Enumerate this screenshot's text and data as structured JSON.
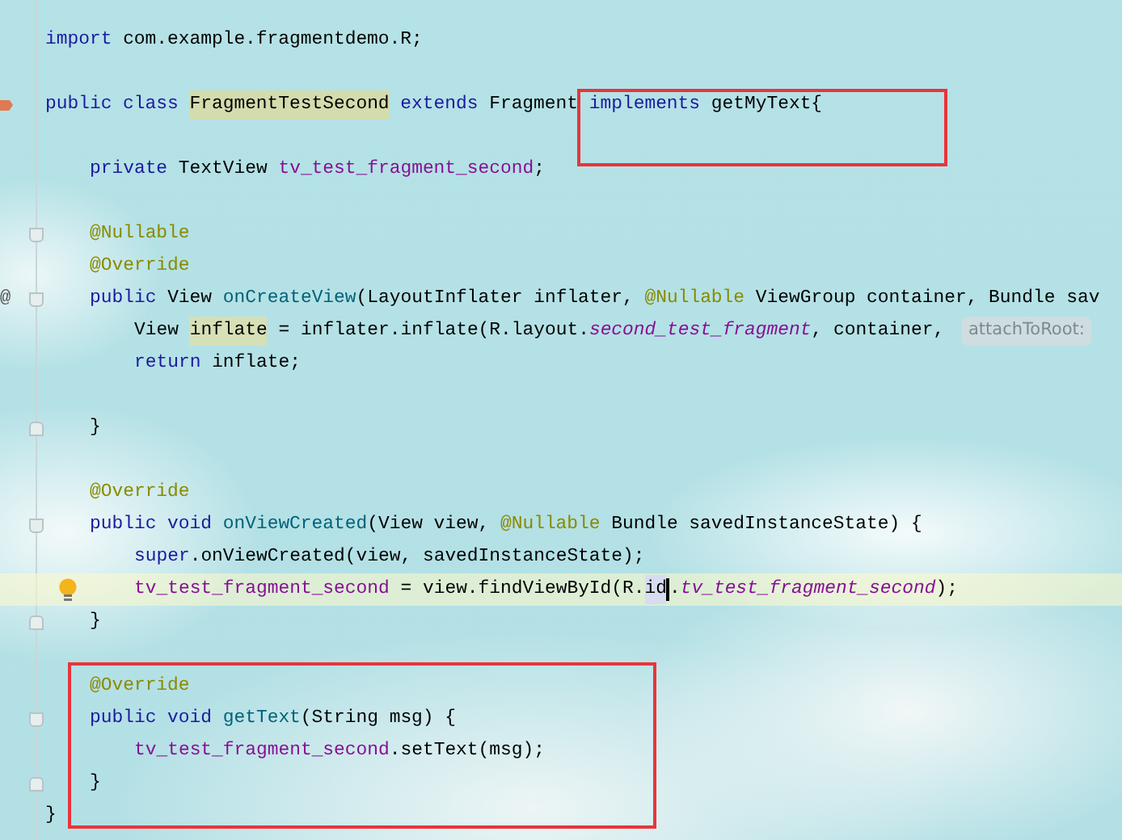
{
  "lines": [
    {
      "kind": "code",
      "tokens": [
        {
          "text": "import",
          "kind": "keyword"
        },
        {
          "text": " com.example.fragmentdemo.R;",
          "kind": "plain"
        }
      ]
    },
    {
      "kind": "blank"
    },
    {
      "kind": "code",
      "implemented_marker": true,
      "tokens": [
        {
          "text": "public class ",
          "kind": "keyword"
        },
        {
          "text": "FragmentTestSecond",
          "kind": "class-highlight"
        },
        {
          "text": " extends ",
          "kind": "keyword"
        },
        {
          "text": "Fragment ",
          "kind": "plain"
        },
        {
          "text": "implements",
          "kind": "keyword"
        },
        {
          "text": " getMyText{",
          "kind": "plain"
        }
      ],
      "children": [
        {
          "kind": "blank"
        },
        {
          "kind": "code",
          "tokens": [
            {
              "text": "private",
              "kind": "keyword"
            },
            {
              "text": " TextView ",
              "kind": "plain"
            },
            {
              "text": "tv_test_fragment_second",
              "kind": "field"
            },
            {
              "text": ";",
              "kind": "plain"
            }
          ]
        },
        {
          "kind": "blank"
        },
        {
          "kind": "code",
          "fold_start": true,
          "tokens": [
            {
              "text": "@Nullable",
              "kind": "annotation"
            }
          ]
        },
        {
          "kind": "code",
          "tokens": [
            {
              "text": "@Override",
              "kind": "annotation"
            }
          ]
        },
        {
          "kind": "code",
          "fold_start": true,
          "gutter_text": "@",
          "tokens": [
            {
              "text": "public",
              "kind": "keyword"
            },
            {
              "text": " View ",
              "kind": "plain"
            },
            {
              "text": "onCreateView",
              "kind": "method"
            },
            {
              "text": "(LayoutInflater inflater, ",
              "kind": "plain"
            },
            {
              "text": "@Nullable",
              "kind": "annotation"
            },
            {
              "text": " ViewGroup container, Bundle sav",
              "kind": "plain"
            }
          ],
          "children": [
            {
              "kind": "code",
              "tokens": [
                {
                  "text": "View ",
                  "kind": "plain"
                },
                {
                  "text": "inflate",
                  "kind": "variable-highlight"
                },
                {
                  "text": " = inflater.inflate(R.layout.",
                  "kind": "plain"
                },
                {
                  "text": "second_test_fragment",
                  "kind": "constant"
                },
                {
                  "text": ", container, ",
                  "kind": "plain"
                },
                {
                  "text": "attachToRoot:",
                  "kind": "hint"
                }
              ]
            },
            {
              "kind": "code",
              "tokens": [
                {
                  "text": "return",
                  "kind": "keyword"
                },
                {
                  "text": " inflate;",
                  "kind": "plain"
                }
              ]
            },
            {
              "kind": "blank"
            }
          ]
        },
        {
          "kind": "code",
          "fold_end": true,
          "tokens": [
            {
              "text": "}",
              "kind": "plain"
            }
          ]
        },
        {
          "kind": "blank"
        },
        {
          "kind": "code",
          "tokens": [
            {
              "text": "@Override",
              "kind": "annotation"
            }
          ]
        },
        {
          "kind": "code",
          "fold_start": true,
          "tokens": [
            {
              "text": "public void ",
              "kind": "keyword"
            },
            {
              "text": "onViewCreated",
              "kind": "method"
            },
            {
              "text": "(View view, ",
              "kind": "plain"
            },
            {
              "text": "@Nullable",
              "kind": "annotation"
            },
            {
              "text": " Bundle savedInstanceState) {",
              "kind": "plain"
            }
          ],
          "children": [
            {
              "kind": "code",
              "tokens": [
                {
                  "text": "super",
                  "kind": "keyword"
                },
                {
                  "text": ".onViewCreated(view, savedInstanceState);",
                  "kind": "plain"
                }
              ]
            },
            {
              "kind": "code",
              "current": true,
              "bulb": true,
              "tokens": [
                {
                  "text": "tv_test_fragment_second",
                  "kind": "field"
                },
                {
                  "text": " = view.findViewById(R.",
                  "kind": "plain"
                },
                {
                  "text": "id",
                  "kind": "caret-match"
                },
                {
                  "text": ".",
                  "kind": "plain"
                },
                {
                  "text": "tv_test_fragment_second",
                  "kind": "constant"
                },
                {
                  "text": ");",
                  "kind": "plain"
                }
              ]
            }
          ]
        },
        {
          "kind": "code",
          "fold_end": true,
          "tokens": [
            {
              "text": "}",
              "kind": "plain"
            }
          ]
        },
        {
          "kind": "blank"
        },
        {
          "kind": "code",
          "tokens": [
            {
              "text": "@Override",
              "kind": "annotation"
            }
          ]
        },
        {
          "kind": "code",
          "fold_start": true,
          "tokens": [
            {
              "text": "public void ",
              "kind": "keyword"
            },
            {
              "text": "getText",
              "kind": "method"
            },
            {
              "text": "(String msg) {",
              "kind": "plain"
            }
          ],
          "children": [
            {
              "kind": "code",
              "tokens": [
                {
                  "text": "tv_test_fragment_second",
                  "kind": "field"
                },
                {
                  "text": ".setText(msg);",
                  "kind": "plain"
                }
              ]
            }
          ]
        },
        {
          "kind": "code",
          "fold_end": true,
          "tokens": [
            {
              "text": "}",
              "kind": "plain"
            }
          ]
        }
      ]
    },
    {
      "kind": "code",
      "tokens": [
        {
          "text": "}",
          "kind": "plain"
        }
      ]
    }
  ],
  "callouts": {
    "header": true,
    "method_block": true
  }
}
